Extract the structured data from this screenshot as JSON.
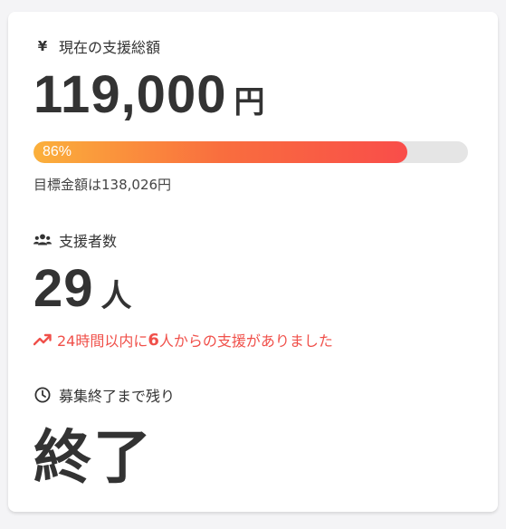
{
  "total": {
    "label": "現在の支援総額",
    "amount": "119,000",
    "unit": "円",
    "progress_percent": 86,
    "progress_label": "86%",
    "goal_text": "目標金額は138,026円"
  },
  "supporters": {
    "label": "支援者数",
    "count": "29",
    "unit": "人",
    "trend_prefix": "24時間以内に",
    "trend_count": "6",
    "trend_suffix": "人からの支援がありました"
  },
  "remaining": {
    "label": "募集終了まで残り",
    "value": "終了"
  },
  "colors": {
    "text": "#333333",
    "accent_red": "#f0504a",
    "progress_start": "#fbb03b",
    "progress_end": "#f94d4a",
    "track": "#e5e5e5"
  },
  "icons": {
    "total": "yen-icon",
    "supporters": "users-icon",
    "trend": "trending-up-icon",
    "remaining": "clock-icon"
  }
}
